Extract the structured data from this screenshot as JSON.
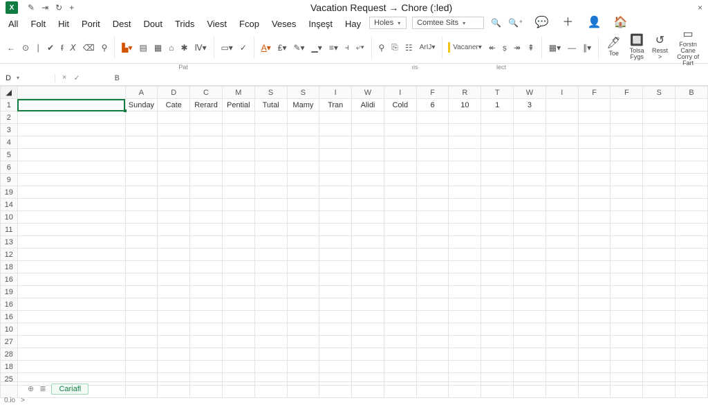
{
  "title": "Vacation Request → Chore (:led)",
  "app_badge": "X",
  "menu_tabs": [
    "All",
    "Folt",
    "Hit",
    "Porit",
    "Dest",
    "Dout",
    "Trids",
    "Viest",
    "Fcop",
    "Veses",
    "Inşeşt",
    "Hay"
  ],
  "ribbon": {
    "style_select": "Holes",
    "font_select": "Comtee Sits",
    "vacaner_label": "Vacaner",
    "btn_toe": "Toe",
    "btn_tolsa": "Tolsa Fygs",
    "btn_resst": "Resst >",
    "btn_foc": "Forstn Cane Corry of Fart",
    "section_pat": "Pat",
    "section_ns": "ıis",
    "section_lect": "lect"
  },
  "formula": {
    "name_box": "D",
    "fx_label": "B"
  },
  "columns": [
    "",
    "A",
    "D",
    "C",
    "M",
    "S",
    "S",
    "I",
    "W",
    "I",
    "F",
    "R",
    "T",
    "W",
    "I",
    "F",
    "F",
    "S",
    "B"
  ],
  "row_numbers": [
    "1",
    "2",
    "3",
    "4",
    "5",
    "6",
    "9",
    "19",
    "14",
    "10",
    "11",
    "13",
    "12",
    "18",
    "16",
    "19",
    "16",
    "16",
    "10",
    "27",
    "28",
    "18",
    "25",
    ""
  ],
  "row1": [
    "Sunday",
    "Cate",
    "Rerard",
    "Pential",
    "Tutal",
    "Mamy",
    "Tran",
    "Alidi",
    "Cold",
    "6",
    "10",
    "1",
    "3",
    "",
    "",
    "",
    "",
    ""
  ],
  "sheet": {
    "tab": "Cariafl"
  },
  "status": {
    "left": "0.io",
    "caret": ">"
  }
}
